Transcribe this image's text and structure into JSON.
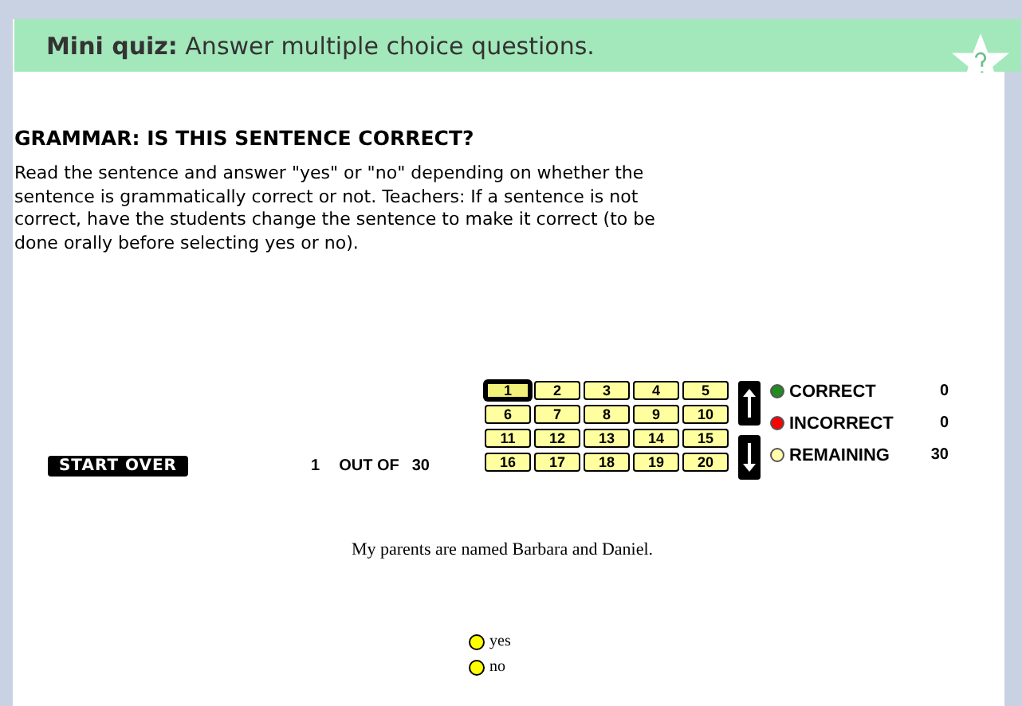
{
  "banner": {
    "label": "Mini quiz:",
    "text": "Answer multiple choice questions."
  },
  "heading": "GRAMMAR: IS THIS SENTENCE CORRECT?",
  "instructions": "Read the sentence and answer \"yes\" or \"no\" depending on whether the sentence is grammatically correct or not. Teachers: If a sentence is not correct, have the students change the sentence to make it correct (to be done orally before selecting yes or no).",
  "start_over": "START OVER",
  "progress": {
    "current": "1",
    "out_of": "OUT OF",
    "total": "30"
  },
  "questions": [
    {
      "label": "1",
      "selected": true
    },
    {
      "label": "2",
      "selected": false
    },
    {
      "label": "3",
      "selected": false
    },
    {
      "label": "4",
      "selected": false
    },
    {
      "label": "5",
      "selected": false
    },
    {
      "label": "6",
      "selected": false
    },
    {
      "label": "7",
      "selected": false
    },
    {
      "label": "8",
      "selected": false
    },
    {
      "label": "9",
      "selected": false
    },
    {
      "label": "10",
      "selected": false
    },
    {
      "label": "11",
      "selected": false
    },
    {
      "label": "12",
      "selected": false
    },
    {
      "label": "13",
      "selected": false
    },
    {
      "label": "14",
      "selected": false
    },
    {
      "label": "15",
      "selected": false
    },
    {
      "label": "16",
      "selected": false
    },
    {
      "label": "17",
      "selected": false
    },
    {
      "label": "18",
      "selected": false
    },
    {
      "label": "19",
      "selected": false
    },
    {
      "label": "20",
      "selected": false
    }
  ],
  "score": [
    {
      "label": "CORRECT",
      "value": "0",
      "color": "#228b22"
    },
    {
      "label": "INCORRECT",
      "value": "0",
      "color": "#ff0000"
    },
    {
      "label": "REMAINING",
      "value": "30",
      "color": "#ffffaa"
    }
  ],
  "sentence": "My parents are named Barbara and Daniel.",
  "answers": [
    {
      "label": "yes",
      "selected": false
    },
    {
      "label": "no",
      "selected": false
    }
  ]
}
